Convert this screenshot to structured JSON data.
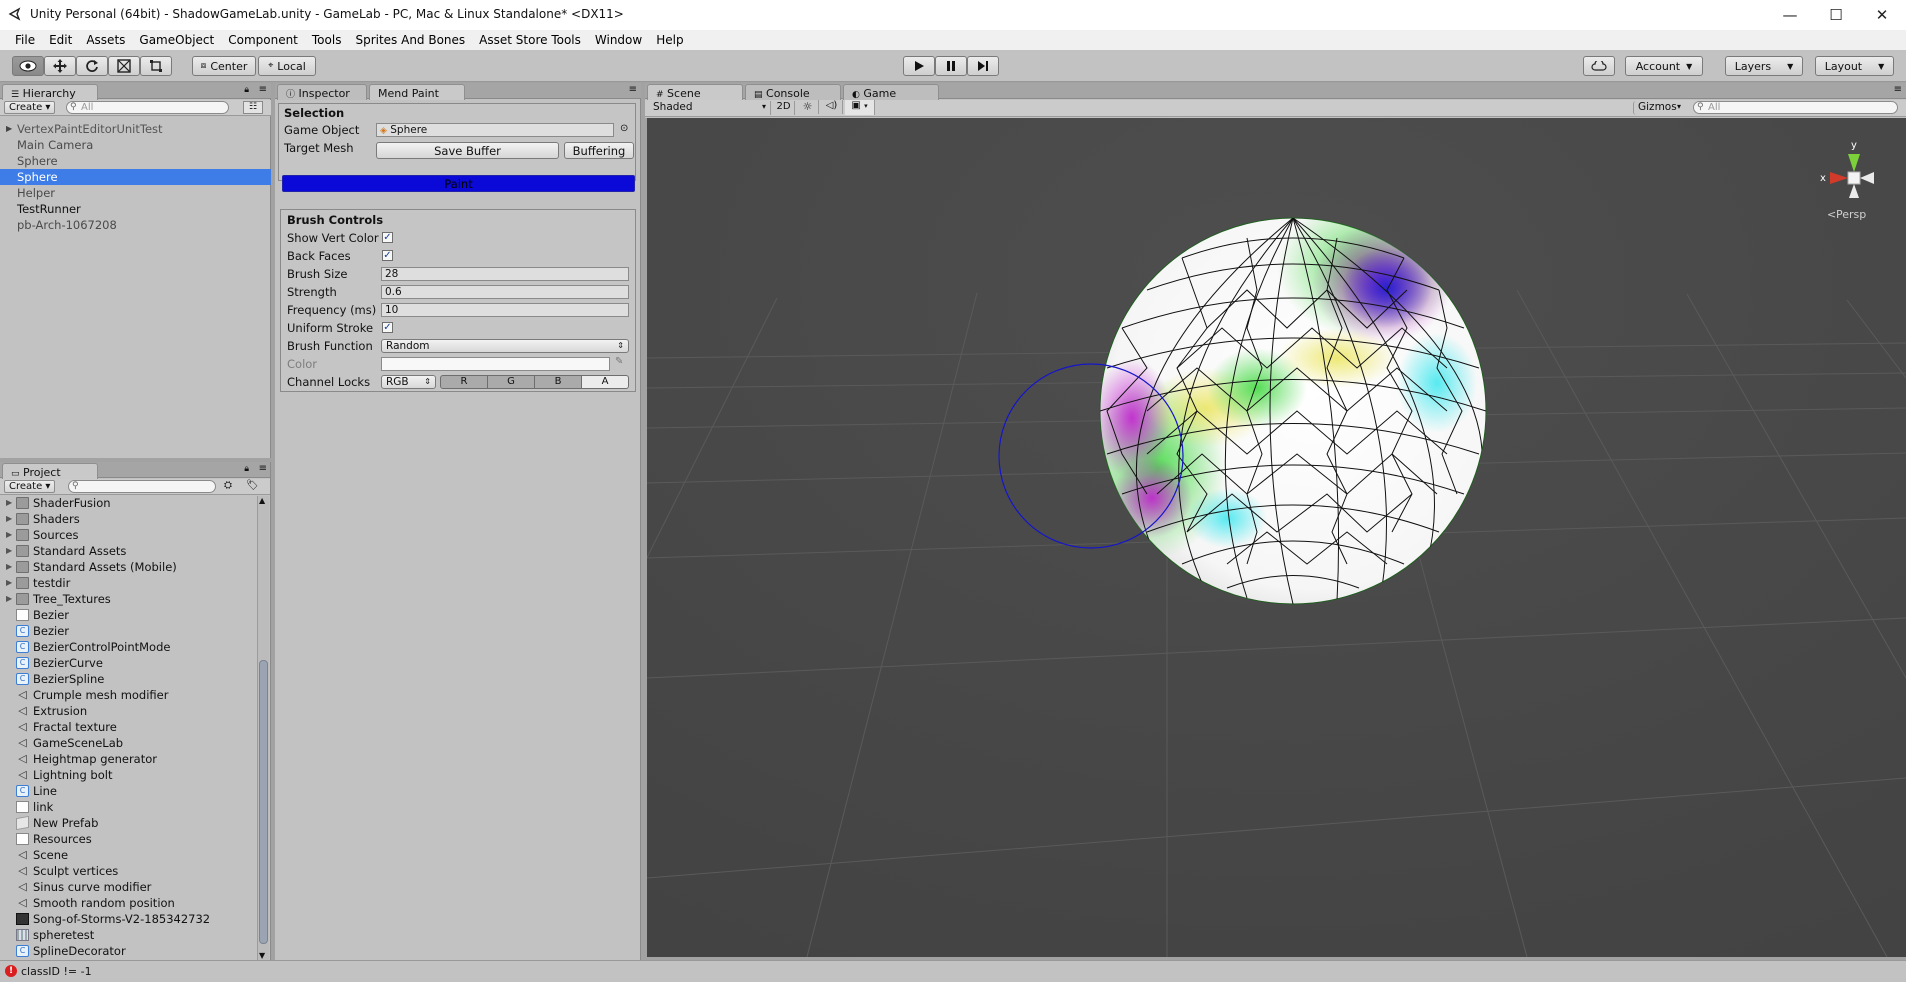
{
  "window": {
    "title": "Unity Personal (64bit) - ShadowGameLab.unity - GameLab - PC, Mac & Linux Standalone* <DX11>",
    "controls": {
      "minimize": "—",
      "maximize": "☐",
      "close": "✕"
    }
  },
  "menu": [
    "File",
    "Edit",
    "Assets",
    "GameObject",
    "Component",
    "Tools",
    "Sprites And Bones",
    "Asset Store Tools",
    "Window",
    "Help"
  ],
  "toolbar": {
    "pivot": "Center",
    "space": "Local",
    "account": "Account",
    "layers": "Layers",
    "layout": "Layout"
  },
  "hierarchy": {
    "tab": "Hierarchy",
    "create": "Create",
    "search_placeholder": "All",
    "items": [
      {
        "label": "VertexPaintEditorUnitTest"
      },
      {
        "label": "Main Camera"
      },
      {
        "label": "Sphere"
      },
      {
        "label": "Sphere"
      },
      {
        "label": "Helper"
      },
      {
        "label": "TestRunner"
      },
      {
        "label": "pb-Arch-1067208"
      }
    ]
  },
  "project": {
    "tab": "Project",
    "create": "Create",
    "items": [
      {
        "label": "ShaderFusion"
      },
      {
        "label": "Shaders"
      },
      {
        "label": "Sources"
      },
      {
        "label": "Standard Assets"
      },
      {
        "label": "Standard Assets (Mobile)"
      },
      {
        "label": "testdir"
      },
      {
        "label": "Tree_Textures"
      },
      {
        "label": "Bezier"
      },
      {
        "label": "Bezier"
      },
      {
        "label": "BezierControlPointMode"
      },
      {
        "label": "BezierCurve"
      },
      {
        "label": "BezierSpline"
      },
      {
        "label": "Crumple mesh modifier"
      },
      {
        "label": "Extrusion"
      },
      {
        "label": "Fractal texture"
      },
      {
        "label": "GameSceneLab"
      },
      {
        "label": "Heightmap generator"
      },
      {
        "label": "Lightning bolt"
      },
      {
        "label": "Line"
      },
      {
        "label": "link"
      },
      {
        "label": "New Prefab"
      },
      {
        "label": "Resources"
      },
      {
        "label": "Scene"
      },
      {
        "label": "Sculpt vertices"
      },
      {
        "label": "Sinus curve modifier"
      },
      {
        "label": "Smooth random position"
      },
      {
        "label": "Song-of-Storms-V2-185342732"
      },
      {
        "label": "spheretest"
      },
      {
        "label": "SplineDecorator"
      }
    ]
  },
  "inspector": {
    "tab_inspector": "Inspector",
    "tab_mend": "Mend Paint",
    "selection_header": "Selection",
    "game_object_label": "Game Object",
    "game_object_value": "Sphere",
    "target_mesh_label": "Target Mesh",
    "save_buffer": "Save Buffer",
    "buffering": "Buffering",
    "paint": "Paint",
    "brush_header": "Brush Controls",
    "show_vert_color": "Show Vert Color",
    "back_faces": "Back Faces",
    "brush_size_label": "Brush Size",
    "brush_size": "28",
    "strength_label": "Strength",
    "strength": "0.6",
    "frequency_label": "Frequency (ms)",
    "frequency": "10",
    "uniform_stroke": "Uniform Stroke",
    "brush_function_label": "Brush Function",
    "brush_function": "Random",
    "color_label": "Color",
    "channel_locks_label": "Channel Locks",
    "channel_mode": "RGB",
    "channels": [
      "R",
      "G",
      "B",
      "A"
    ]
  },
  "scene": {
    "tab_scene": "Scene",
    "tab_console": "Console",
    "tab_game": "Game",
    "shading": "Shaded",
    "mode_2d": "2D",
    "gizmos": "Gizmos",
    "search_placeholder": "All",
    "persp": "Persp",
    "axis_x": "x",
    "axis_y": "y"
  },
  "status": {
    "message": "classID != -1",
    "error_color": "#d81e1e"
  }
}
